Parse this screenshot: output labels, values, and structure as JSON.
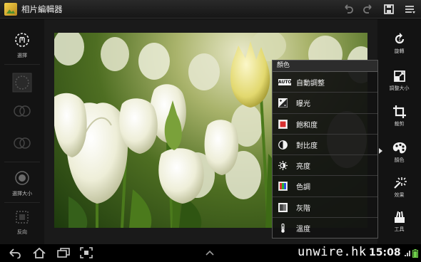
{
  "titlebar": {
    "title": "相片編輯器",
    "icons": [
      "photo-app-icon",
      "undo-icon",
      "redo-icon",
      "save-icon",
      "menu-icon"
    ]
  },
  "left_panel": {
    "items": [
      {
        "name": "select-tool",
        "label": "選擇",
        "icon": "lasso-select-icon"
      },
      {
        "name": "circle-select",
        "label": "",
        "icon": "circle-select-icon"
      },
      {
        "name": "add-select",
        "label": "",
        "icon": "double-circle-add-icon"
      },
      {
        "name": "subtract-select",
        "label": "",
        "icon": "double-circle-subtract-icon"
      },
      {
        "name": "brush-size",
        "label": "選擇大小",
        "icon": "brush-size-icon"
      },
      {
        "name": "invert",
        "label": "反向",
        "icon": "invert-select-icon"
      }
    ]
  },
  "right_panel": {
    "items": [
      {
        "label": "旋轉",
        "icon": "rotate-icon"
      },
      {
        "label": "調整大小",
        "icon": "resize-icon"
      },
      {
        "label": "裁剪",
        "icon": "crop-icon"
      },
      {
        "label": "顏色",
        "icon": "palette-icon"
      },
      {
        "label": "效果",
        "icon": "effects-icon"
      },
      {
        "label": "工具",
        "icon": "tools-icon"
      }
    ]
  },
  "color_menu": {
    "title": "顏色",
    "items": [
      {
        "label": "自動調整",
        "icon": "auto-adjust-icon",
        "badge": "AUTO"
      },
      {
        "label": "曝光",
        "icon": "exposure-icon"
      },
      {
        "label": "飽和度",
        "icon": "saturation-icon"
      },
      {
        "label": "對比度",
        "icon": "contrast-icon"
      },
      {
        "label": "亮度",
        "icon": "brightness-icon"
      },
      {
        "label": "色調",
        "icon": "hue-icon"
      },
      {
        "label": "灰階",
        "icon": "grayscale-icon"
      },
      {
        "label": "溫度",
        "icon": "temperature-icon"
      }
    ]
  },
  "navbar": {
    "watermark": "unwire.hk",
    "clock": "15:08",
    "icons": [
      "back-icon",
      "home-icon",
      "recent-apps-icon",
      "screenshot-icon",
      "expand-up-icon",
      "signal-icon",
      "battery-icon"
    ]
  },
  "colors": {
    "background": "#0c0c0c",
    "panel": "#131313",
    "menu_header": "#2c2c2c",
    "tulip_white": "#f2f2dc",
    "tulip_yellow": "#e9e27a",
    "leaf_green": "#4e7a1e"
  }
}
